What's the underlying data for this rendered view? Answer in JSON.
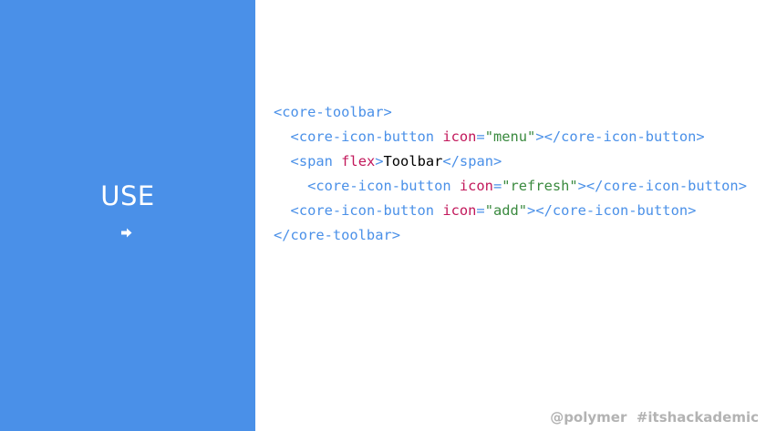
{
  "slide": {
    "title": "USE",
    "arrow_icon": "arrow-right-icon",
    "colors": {
      "panel_background": "#4a90e8",
      "tag": "#4a90e8",
      "attribute": "#c2185b",
      "value": "#3a8a3f",
      "text": "#000000",
      "footer": "#b3b3b3"
    }
  },
  "code": {
    "lines": [
      {
        "indent": "",
        "tokens": [
          {
            "type": "tag",
            "text": "<core-toolbar>"
          }
        ]
      },
      {
        "indent": "  ",
        "tokens": [
          {
            "type": "tag",
            "text": "<core-icon-button "
          },
          {
            "type": "attr",
            "text": "icon"
          },
          {
            "type": "eq",
            "text": "="
          },
          {
            "type": "val",
            "text": "\"menu\""
          },
          {
            "type": "tag",
            "text": "></core-icon-button>"
          }
        ]
      },
      {
        "indent": "  ",
        "tokens": [
          {
            "type": "tag",
            "text": "<span "
          },
          {
            "type": "attr",
            "text": "flex"
          },
          {
            "type": "tag",
            "text": ">"
          },
          {
            "type": "text",
            "text": "Toolbar"
          },
          {
            "type": "tag",
            "text": "</span>"
          }
        ]
      },
      {
        "indent": "    ",
        "tokens": [
          {
            "type": "tag",
            "text": "<core-icon-button "
          },
          {
            "type": "attr",
            "text": "icon"
          },
          {
            "type": "eq",
            "text": "="
          },
          {
            "type": "val",
            "text": "\"refresh\""
          },
          {
            "type": "tag",
            "text": "></core-icon-button>"
          }
        ]
      },
      {
        "indent": "  ",
        "tokens": [
          {
            "type": "tag",
            "text": "<core-icon-button "
          },
          {
            "type": "attr",
            "text": "icon"
          },
          {
            "type": "eq",
            "text": "="
          },
          {
            "type": "val",
            "text": "\"add\""
          },
          {
            "type": "tag",
            "text": "></core-icon-button>"
          }
        ]
      },
      {
        "indent": "",
        "tokens": [
          {
            "type": "tag",
            "text": "</core-toolbar>"
          }
        ]
      }
    ]
  },
  "footer": {
    "handle": "@polymer",
    "hashtag": "#itshackademic"
  }
}
